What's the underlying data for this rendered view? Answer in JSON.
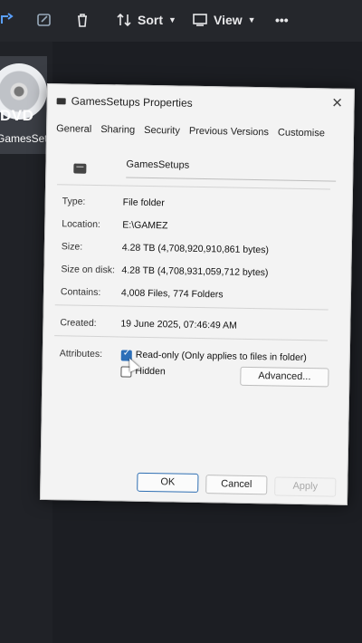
{
  "toolbar": {
    "sort_label": "Sort",
    "view_label": "View",
    "more_label": "•••"
  },
  "left_pane": {
    "drive_badge": "DVD",
    "drive_name": "GamesSetups"
  },
  "dialog": {
    "title": "GamesSetups Properties",
    "close_glyph": "✕",
    "tabs": [
      {
        "label": "General"
      },
      {
        "label": "Sharing"
      },
      {
        "label": "Security"
      },
      {
        "label": "Previous Versions"
      },
      {
        "label": "Customise"
      }
    ],
    "name": "GamesSetups",
    "fields": {
      "type_label": "Type:",
      "type_value": "File folder",
      "location_label": "Location:",
      "location_value": "E:\\GAMEZ",
      "size_label": "Size:",
      "size_value": "4.28 TB (4,708,920,910,861 bytes)",
      "size_on_disk_label": "Size on disk:",
      "size_on_disk_value": "4.28 TB (4,708,931,059,712 bytes)",
      "contains_label": "Contains:",
      "contains_value": "4,008 Files, 774 Folders",
      "created_label": "Created:",
      "created_value": "19 June 2025, 07:46:49 AM",
      "attributes_label": "Attributes:"
    },
    "attributes": {
      "readonly_label": "Read-only (Only applies to files in folder)",
      "hidden_label": "Hidden",
      "advanced_label": "Advanced..."
    },
    "buttons": {
      "ok": "OK",
      "cancel": "Cancel",
      "apply": "Apply"
    }
  },
  "colors": {
    "accent": "#2d6fb8",
    "dialog_bg": "#f3f3f3",
    "toolbar_bg": "#25272c"
  }
}
